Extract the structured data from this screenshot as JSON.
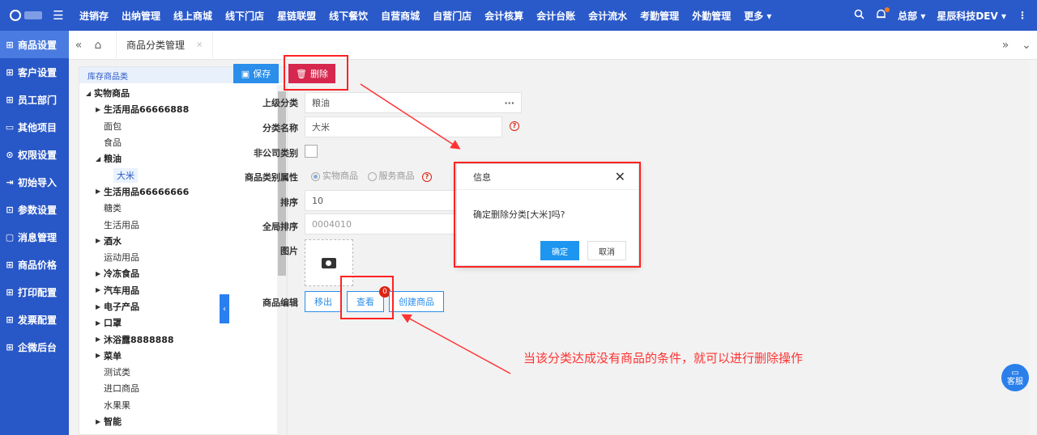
{
  "topbar": {
    "menu_icon": "hamburger-icon",
    "nav": [
      "进销存",
      "出纳管理",
      "线上商城",
      "线下门店",
      "星链联盟",
      "线下餐饮",
      "自营商城",
      "自营门店",
      "会计核算",
      "会计台账",
      "会计流水",
      "考勤管理",
      "外勤管理",
      "更多 ▾"
    ],
    "org": "总部 ▾",
    "company": "星辰科技DEV ▾"
  },
  "sidebar": {
    "items": [
      {
        "label": "商品设置",
        "icon": "grid-icon"
      },
      {
        "label": "客户设置",
        "icon": "grid-icon"
      },
      {
        "label": "员工部门",
        "icon": "grid-icon"
      },
      {
        "label": "其他项目",
        "icon": "folder-icon"
      },
      {
        "label": "权限设置",
        "icon": "shield-icon"
      },
      {
        "label": "初始导入",
        "icon": "import-icon"
      },
      {
        "label": "参数设置",
        "icon": "settings-icon"
      },
      {
        "label": "消息管理",
        "icon": "message-icon"
      },
      {
        "label": "商品价格",
        "icon": "grid-icon"
      },
      {
        "label": "打印配置",
        "icon": "grid-icon"
      },
      {
        "label": "发票配置",
        "icon": "grid-icon"
      },
      {
        "label": "企微后台",
        "icon": "grid-icon"
      }
    ]
  },
  "tabs": {
    "active_label": "商品分类管理",
    "close": "×"
  },
  "tree": {
    "header": "库存商品类",
    "nodes": [
      {
        "label": "实物商品",
        "arrow": "◢",
        "indent": 0,
        "style": "bold"
      },
      {
        "label": "生活用品66666888",
        "arrow": "▶",
        "indent": 1,
        "style": "bold"
      },
      {
        "label": "面包",
        "arrow": "",
        "indent": 1,
        "style": "plain"
      },
      {
        "label": "食品",
        "arrow": "",
        "indent": 1,
        "style": "plain"
      },
      {
        "label": "粮油",
        "arrow": "◢",
        "indent": 1,
        "style": "bold"
      },
      {
        "label": "大米",
        "arrow": "",
        "indent": 2,
        "style": "sel"
      },
      {
        "label": "生活用品66666666",
        "arrow": "▶",
        "indent": 1,
        "style": "bold"
      },
      {
        "label": "糖类",
        "arrow": "",
        "indent": 1,
        "style": "plain"
      },
      {
        "label": "生活用品",
        "arrow": "",
        "indent": 1,
        "style": "plain"
      },
      {
        "label": "酒水",
        "arrow": "▶",
        "indent": 1,
        "style": "bold"
      },
      {
        "label": "运动用品",
        "arrow": "",
        "indent": 1,
        "style": "plain"
      },
      {
        "label": "冷冻食品",
        "arrow": "▶",
        "indent": 1,
        "style": "bold"
      },
      {
        "label": "汽车用品",
        "arrow": "▶",
        "indent": 1,
        "style": "bold"
      },
      {
        "label": "电子产品",
        "arrow": "▶",
        "indent": 1,
        "style": "bold"
      },
      {
        "label": "口罩",
        "arrow": "▶",
        "indent": 1,
        "style": "bold"
      },
      {
        "label": "沐浴露8888888",
        "arrow": "▶",
        "indent": 1,
        "style": "bold"
      },
      {
        "label": "菜单",
        "arrow": "▶",
        "indent": 1,
        "style": "bold"
      },
      {
        "label": "测试类",
        "arrow": "",
        "indent": 1,
        "style": "plain"
      },
      {
        "label": "进口商品",
        "arrow": "",
        "indent": 1,
        "style": "plain"
      },
      {
        "label": "水果果",
        "arrow": "",
        "indent": 1,
        "style": "plain"
      },
      {
        "label": "智能",
        "arrow": "▶",
        "indent": 1,
        "style": "bold"
      }
    ]
  },
  "toolbar": {
    "save": "保存",
    "delete": "删除"
  },
  "form": {
    "parent_label": "上级分类",
    "parent_value": "粮油",
    "parent_more": "···",
    "name_label": "分类名称",
    "name_value": "大米",
    "noncompany_label": "非公司类别",
    "attr_label": "商品类别属性",
    "attr_opt1": "实物商品",
    "attr_opt2": "服务商品",
    "sort_label": "排序",
    "sort_value": "10",
    "global_sort_label": "全局排序",
    "global_sort_value": "0004010",
    "image_label": "图片",
    "edit_label": "商品编辑",
    "move_out": "移出",
    "view": "查看",
    "view_badge": "0",
    "create": "创建商品"
  },
  "dialog": {
    "title": "信息",
    "message": "确定删除分类[大米]吗?",
    "ok": "确定",
    "cancel": "取消",
    "close": "✕"
  },
  "annotation": "当该分类达成没有商品的条件，就可以进行删除操作",
  "service": {
    "label": "客服"
  },
  "colors": {
    "primary": "#2a59c9",
    "danger": "#d6274e",
    "annotation": "#ff3333"
  }
}
